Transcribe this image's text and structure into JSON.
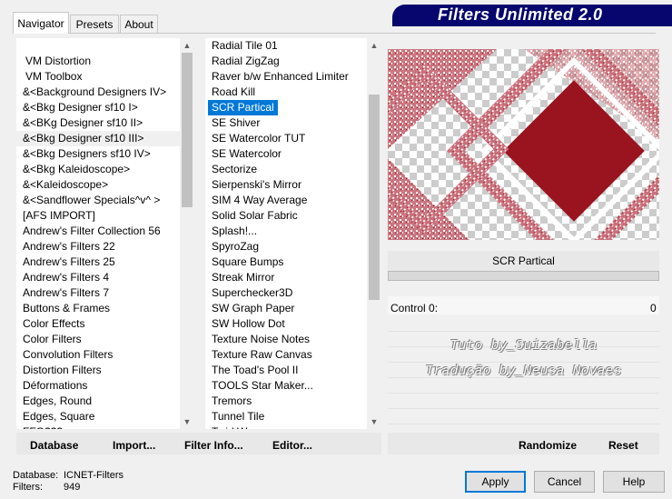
{
  "tabs": [
    "Navigator",
    "Presets",
    "About"
  ],
  "title": "Filters Unlimited 2.0",
  "categories": [
    "VM Distortion",
    "VM Toolbox",
    "&<Background Designers IV>",
    "&<Bkg Designer sf10 I>",
    "&<BKg Designer sf10 II>",
    "&<Bkg Designer sf10 III>",
    "&<Bkg Designers sf10 IV>",
    "&<Bkg Kaleidoscope>",
    "&<Kaleidoscope>",
    "&<Sandflower Specials^v^ >",
    "[AFS IMPORT]",
    "Andrew's Filter Collection 56",
    "Andrew's Filters 22",
    "Andrew's Filters 25",
    "Andrew's Filters 4",
    "Andrew's Filters 7",
    "Buttons & Frames",
    "Color Effects",
    "Color Filters",
    "Convolution Filters",
    "Distortion Filters",
    "Déformations",
    "Edges, Round",
    "Edges, Square",
    "FFG???"
  ],
  "filters": [
    "Radial Tile 01",
    "Radial ZigZag",
    "Raver b/w Enhanced Limiter",
    "Road Kill",
    "SCR  Partical",
    "SE Shiver",
    "SE Watercolor TUT",
    "SE Watercolor",
    "Sectorize",
    "Sierpenski's Mirror",
    "SIM 4 Way Average",
    "Solid Solar Fabric",
    "Splash!...",
    "SpyroZag",
    "Square Bumps",
    "Streak Mirror",
    "Superchecker3D",
    "SW Graph Paper",
    "SW Hollow Dot",
    "Texture Noise Notes",
    "Texture Raw Canvas",
    "The Toad's Pool II",
    "TOOLS Star Maker...",
    "Tremors",
    "Tunnel Tile",
    "Twirl Wave"
  ],
  "selected_filter_index": 4,
  "filter_name": "SCR  Partical",
  "control_label": "Control 0:",
  "control_value": "0",
  "watermark_line1": "Tuto by_Suizabella",
  "watermark_line2": "Tradução by_Neusa Novaes",
  "buttons": {
    "database": "Database",
    "import": "Import...",
    "filter_info": "Filter Info...",
    "editor": "Editor...",
    "randomize": "Randomize",
    "reset": "Reset",
    "apply": "Apply",
    "cancel": "Cancel",
    "help": "Help"
  },
  "status": {
    "database_label": "Database:",
    "database_value": "ICNET-Filters",
    "filters_label": "Filters:",
    "filters_value": "949"
  },
  "colors": {
    "selection": "#0078d7",
    "preview_red": "#9a1420",
    "banner": "#06066e"
  }
}
